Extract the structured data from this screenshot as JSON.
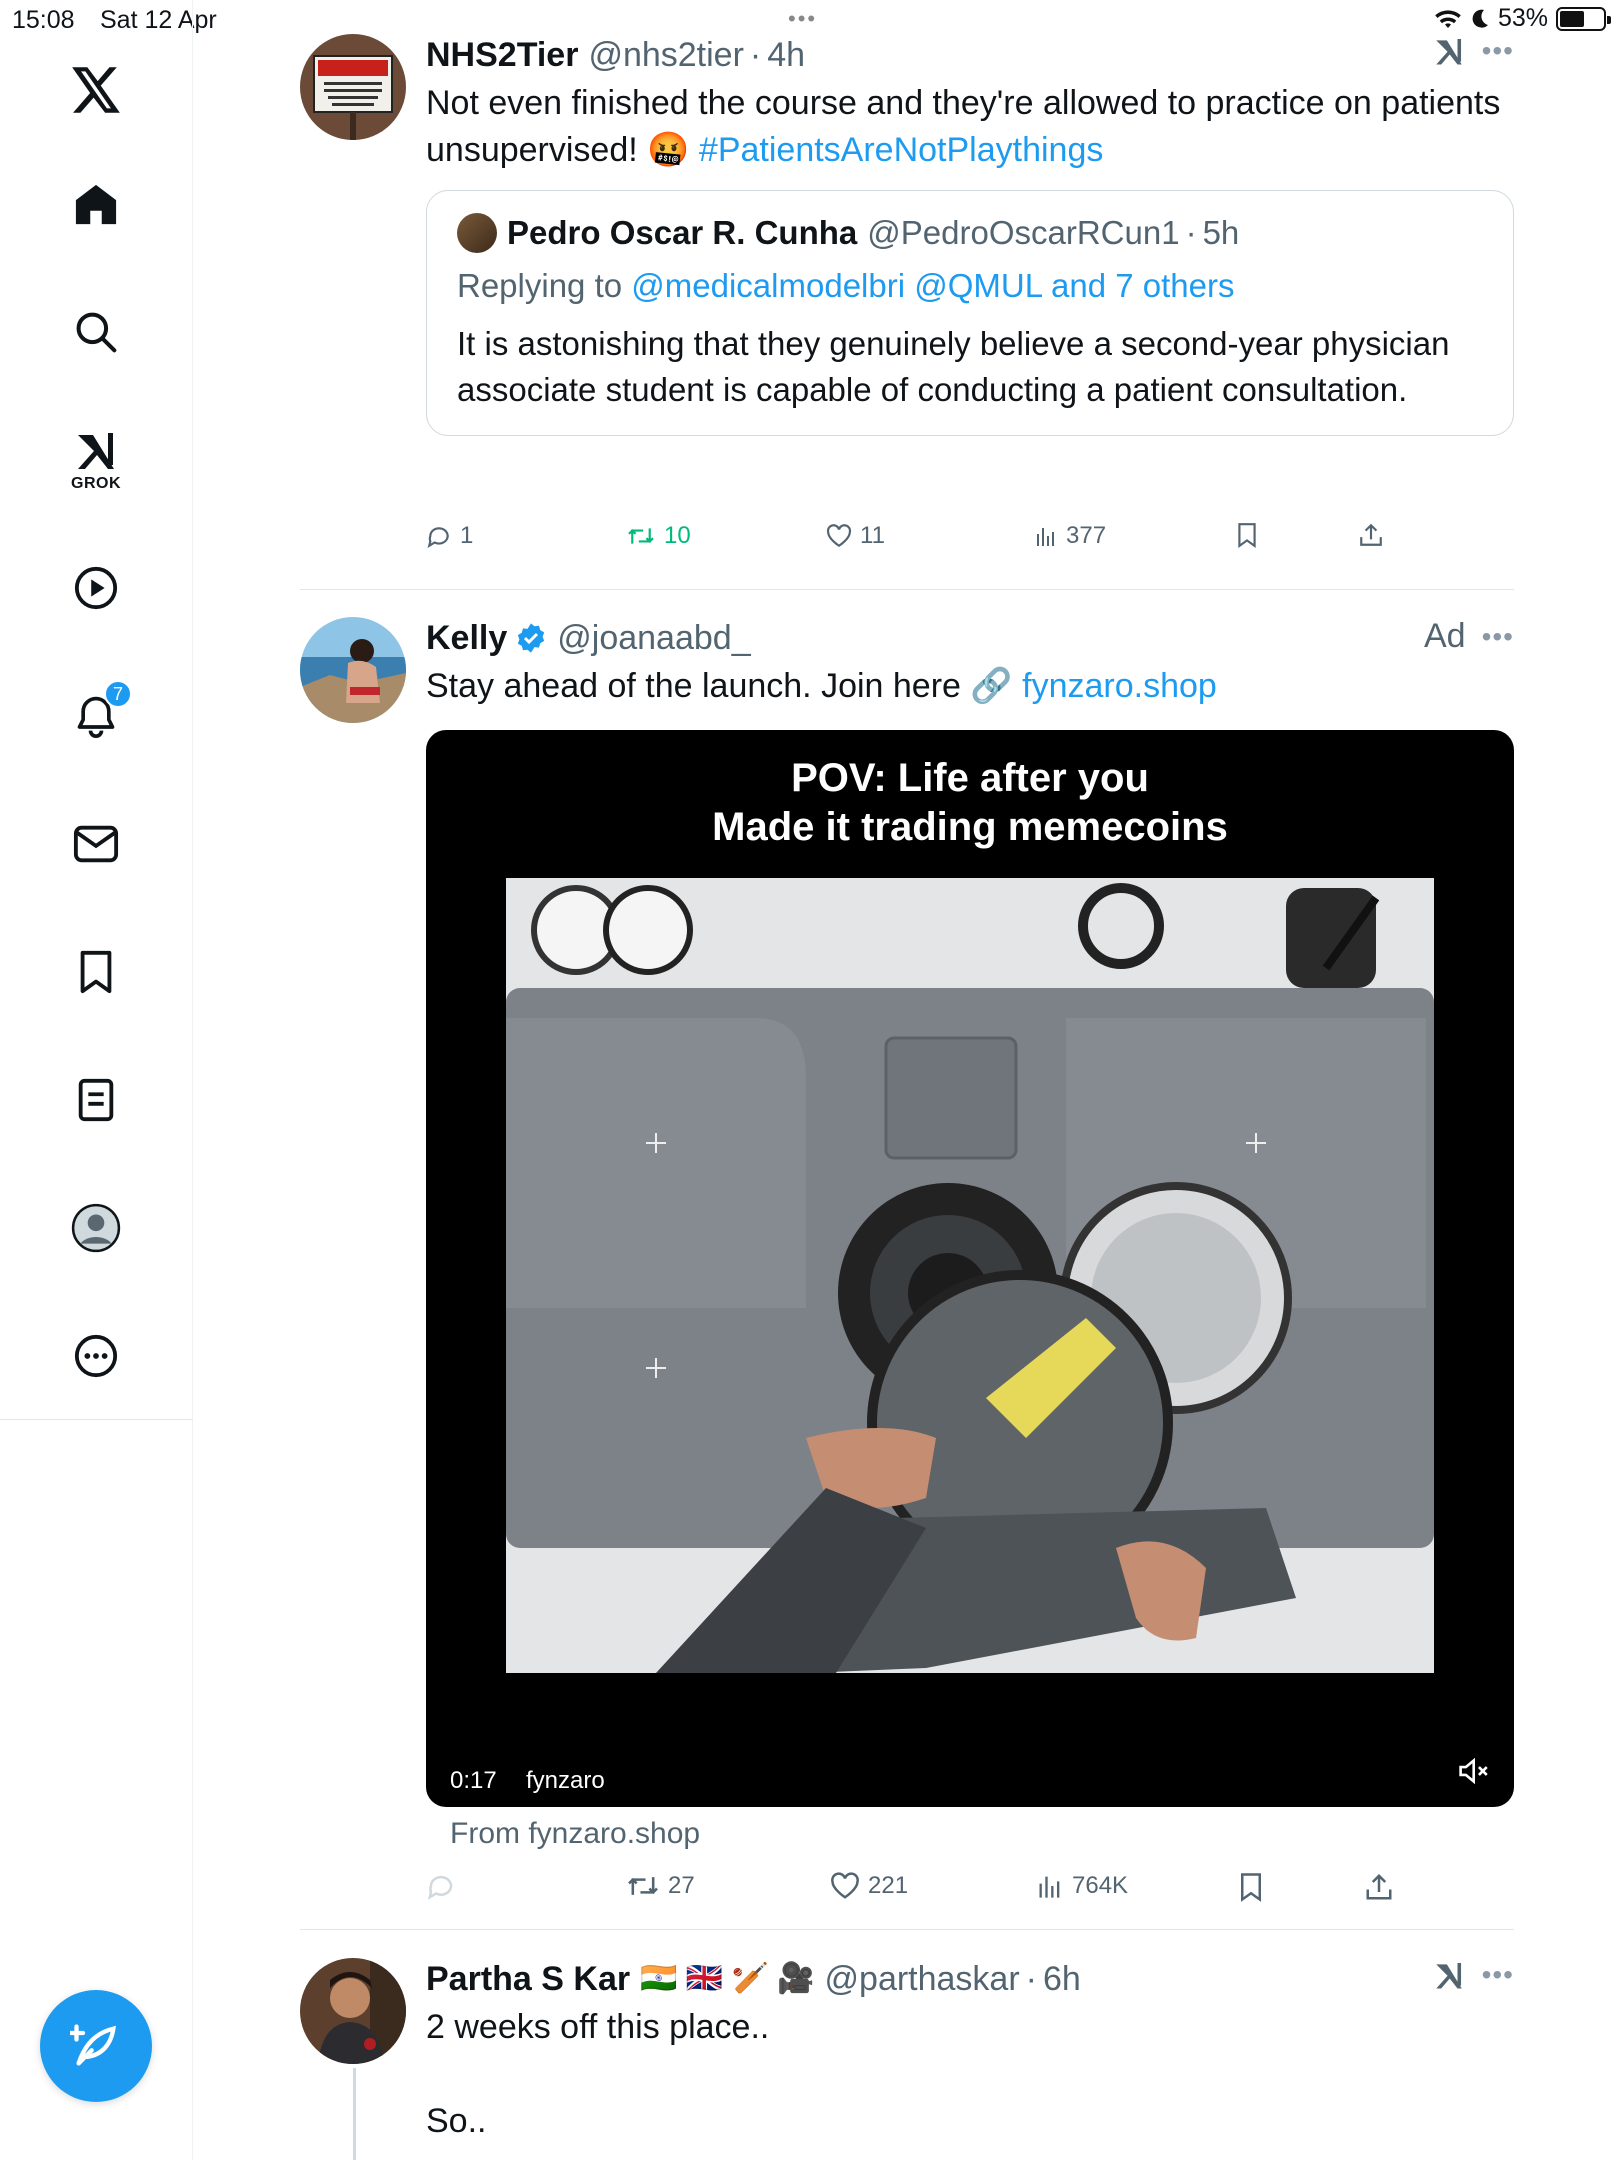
{
  "status_bar": {
    "time": "15:08",
    "date": "Sat 12 Apr",
    "battery": "53%"
  },
  "sidebar": {
    "grok_label": "GROK",
    "notifications_count": "7"
  },
  "tweets": [
    {
      "name": "NHS2Tier",
      "handle": "@nhs2tier",
      "time": "4h",
      "text_line1": "Not even finished the course and they're allowed to practice on patients",
      "text_line2": "unsupervised! 🤬",
      "hashtag": "#PatientsAreNotPlaythings",
      "quote": {
        "name": "Pedro Oscar R. Cunha",
        "handle": "@PedroOscarRCun1",
        "time": "5h",
        "replying_prefix": "Replying to",
        "replying_to": "@medicalmodelbri @QMUL and 7 others",
        "text": "It is astonishing that they genuinely believe a second-year physician associate student is capable of conducting a patient consultation."
      },
      "actions": {
        "replies": "1",
        "reposts": "10",
        "likes": "11",
        "views": "377"
      }
    },
    {
      "name": "Kelly",
      "handle": "@joanaabd_",
      "ad_label": "Ad",
      "text": "Stay ahead of the launch. Join here 🔗",
      "link": "fynzaro.shop",
      "video": {
        "caption_line1": "POV: Life after you",
        "caption_line2": "Made it trading memecoins",
        "time": "0:17",
        "source": "fynzaro"
      },
      "from_label": "From fynzaro.shop",
      "actions": {
        "replies": "",
        "reposts": "27",
        "likes": "221",
        "views": "764K"
      }
    },
    {
      "name": "Partha S Kar",
      "flags": "🇮🇳 🇬🇧 🏏 🎥",
      "handle": "@parthaskar",
      "time": "6h",
      "text_line1": "2 weeks off this place..",
      "text_line2": "So.."
    }
  ],
  "colors": {
    "accent": "#1d9bf0",
    "repost": "#00ba7c",
    "muted": "#536471"
  }
}
